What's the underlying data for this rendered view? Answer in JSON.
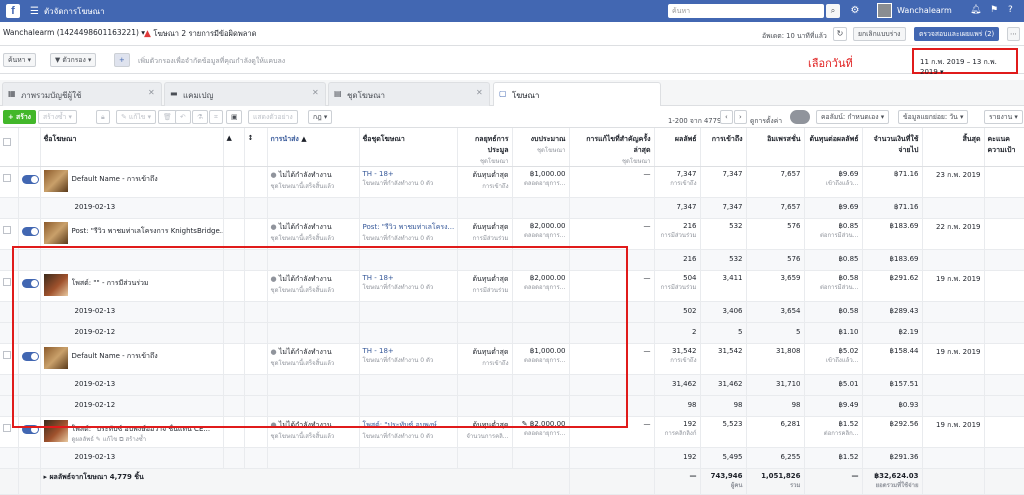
{
  "topbar": {
    "app_title": "ตัวจัดการโฆษณา",
    "search_placeholder": "ค้นหา",
    "user_name": "Wanchalearm"
  },
  "account": {
    "selector": "Wanchalearm (1424498601163221) ▾",
    "warning": "โฆษณา 2 รายการมีข้อผิดพลาด"
  },
  "status": {
    "updated": "อัพเดต: 10 นาทีที่แล้ว",
    "discard": "ยกเลิกแบบร่าง",
    "review": "ตรวจสอบและเผยแพร่ (2)"
  },
  "filter": {
    "search_btn": "ค้นหา ▾",
    "filter_btn": "▼ ตัวกรอง ▾",
    "add": "+",
    "hint": "เพิ่มตัวกรองเพื่อจำกัดข้อมูลที่คุณกำลังดูให้แคบลง"
  },
  "annotation": {
    "label": "เลือกวันที่"
  },
  "date_range": "11 ก.พ. 2019 – 13 ก.พ. 2019 ▾",
  "tabs": [
    {
      "label": "ภาพรวมบัญชีผู้ใช้"
    },
    {
      "label": "แคมเปญ"
    },
    {
      "label": "ชุดโฆษณา"
    },
    {
      "label": "โฆษณา"
    }
  ],
  "toolbar": {
    "create": "+ สร้าง",
    "duplicate": "สร้างซ้ำ ▾",
    "edit": "✎ แก้ไข ▾",
    "test": "แสดงตัวอย่าง",
    "rule": "กฎ ▾",
    "pagination": "1-200 จาก 4779",
    "breakdown_label": "ดูการตั้งค่า",
    "columns": "คอลัมน์: กำหนดเอง ▾",
    "breakdown": "ข้อมูลแยกย่อย: วัน ▾",
    "reports": "รายงาน ▾"
  },
  "columns": {
    "name": "ชื่อโฆษณา",
    "delivery": "การนำส่ง",
    "adset": "ชื่อชุดโฆษณา",
    "bid": "กลยุทธ์การประมูล",
    "bid_sub": "ชุดโฆษณา",
    "budget": "งบประมาณ",
    "budget_sub": "ชุดโฆษณา",
    "changes": "การแก้ไขที่สำคัญครั้งล่าสุด",
    "changes_sub": "ชุดโฆษณา",
    "results": "ผลลัพธ์",
    "reach": "การเข้าถึง",
    "impressions": "อิมเพรสชั่น",
    "cpr": "ต้นทุนต่อผลลัพธ์",
    "spent": "จำนวนเงินที่ใช้จ่ายไป",
    "ends": "สิ้นสุด",
    "cut": "คะแนคความเป้า"
  },
  "rows": [
    {
      "type": "main",
      "name": "Default Name - การเข้าถึง",
      "delivery": "ไม่ได้กำลังทำงาน",
      "delivery_sub": "ชุดโฆษณานี้เสร็จสิ้นแล้ว",
      "adset": "TH - 18+",
      "adset_sub": "โฆษณาที่กำลังทำงาน 0 ตัว",
      "bid": "ต้นทุนต่ำสุด",
      "bid_sub": "การเข้าถึง",
      "budget": "฿1,000.00",
      "budget_sub": "ตลอดอายุการ...",
      "changes": "—",
      "results": "7,347",
      "results_sub": "การเข้าถึง",
      "reach": "7,347",
      "impressions": "7,657",
      "cpr": "฿9.69",
      "cpr_sub": "เข้าถึงแล้ว...",
      "spent": "฿71.16",
      "ends": "23 ก.พ. 2019"
    },
    {
      "type": "sub",
      "name": "2019-02-13",
      "results": "7,347",
      "reach": "7,347",
      "impressions": "7,657",
      "cpr": "฿9.69",
      "spent": "฿71.16"
    },
    {
      "type": "main",
      "name": "Post: \"รีวิว พาชมท่าเลโครงการ KnightsBridge...",
      "delivery": "ไม่ได้กำลังทำงาน",
      "delivery_sub": "ชุดโฆษณานี้เสร็จสิ้นแล้ว",
      "adset": "Post: \"รีวิว พาชมท่าเลโครง...",
      "adset_sub": "โฆษณาที่กำลังทำงาน 0 ตัว",
      "bid": "ต้นทุนต่ำสุด",
      "bid_sub": "การมีส่วนร่วม",
      "budget": "฿2,000.00",
      "budget_sub": "ตลอดอายุการ...",
      "changes": "—",
      "results": "216",
      "results_sub": "การมีส่วนร่วม",
      "reach": "532",
      "impressions": "576",
      "cpr": "฿0.85",
      "cpr_sub": "ต่อการมีส่วน...",
      "spent": "฿183.69",
      "ends": "22 ก.พ. 2019"
    },
    {
      "type": "sub",
      "name": "",
      "results": "216",
      "reach": "532",
      "impressions": "576",
      "cpr": "฿0.85",
      "spent": "฿183.69"
    },
    {
      "type": "main",
      "name": "โพสต์: \"\" - การมีส่วนร่วม",
      "delivery": "ไม่ได้กำลังทำงาน",
      "delivery_sub": "ชุดโฆษณานี้เสร็จสิ้นแล้ว",
      "adset": "TH - 18+",
      "adset_sub": "โฆษณาที่กำลังทำงาน 0 ตัว",
      "bid": "ต้นทุนต่ำสุด",
      "bid_sub": "การมีส่วนร่วม",
      "budget": "฿2,000.00",
      "budget_sub": "ตลอดอายุการ...",
      "changes": "—",
      "results": "504",
      "results_sub": "การมีส่วนร่วม",
      "reach": "3,411",
      "impressions": "3,659",
      "cpr": "฿0.58",
      "cpr_sub": "ต่อการมีส่วน...",
      "spent": "฿291.62",
      "ends": "19 ก.พ. 2019"
    },
    {
      "type": "sub",
      "name": "2019-02-13",
      "results": "502",
      "reach": "3,406",
      "impressions": "3,654",
      "cpr": "฿0.58",
      "spent": "฿289.43"
    },
    {
      "type": "sub",
      "name": "2019-02-12",
      "results": "2",
      "reach": "5",
      "impressions": "5",
      "cpr": "฿1.10",
      "spent": "฿2.19"
    },
    {
      "type": "main",
      "name": "Default Name - การเข้าถึง",
      "delivery": "ไม่ได้กำลังทำงาน",
      "delivery_sub": "ชุดโฆษณานี้เสร็จสิ้นแล้ว",
      "adset": "TH - 18+",
      "adset_sub": "โฆษณาที่กำลังทำงาน 0 ตัว",
      "bid": "ต้นทุนต่ำสุด",
      "bid_sub": "การเข้าถึง",
      "budget": "฿1,000.00",
      "budget_sub": "ตลอดอายุการ...",
      "changes": "—",
      "results": "31,542",
      "results_sub": "การเข้าถึง",
      "reach": "31,542",
      "impressions": "31,808",
      "cpr": "฿5.02",
      "cpr_sub": "เข้าถึงแล้ว...",
      "spent": "฿158.44",
      "ends": "19 ก.พ. 2019"
    },
    {
      "type": "sub",
      "name": "2019-02-13",
      "results": "31,462",
      "reach": "31,462",
      "impressions": "31,710",
      "cpr": "฿5.01",
      "spent": "฿157.51"
    },
    {
      "type": "sub",
      "name": "2019-02-12",
      "results": "98",
      "reach": "98",
      "impressions": "98",
      "cpr": "฿9.49",
      "spent": "฿0.93"
    },
    {
      "type": "main",
      "name": "โพสต์: \"ประทับซ์ อบพงษ์ออวาจ ชื่นแทน CE...",
      "actions": "ดูผลลัพธ์ ✎ แก้ไข ⧉ สร้างซ้ำ",
      "delivery": "ไม่ได้กำลังทำงาน",
      "delivery_sub": "ชุดโฆษณานี้เสร็จสิ้นแล้ว",
      "adset": "โพสต์: \"ประทับซ์ อบพงษ์...",
      "adset_sub": "โฆษณาที่กำลังทำงาน 0 ตัว",
      "bid": "ต้นทุนต่ำสุด",
      "bid_sub": "จำนวนการคลิ...",
      "budget": "✎ ฿2,000.00",
      "budget_sub": "ตลอดอายุการ...",
      "changes": "—",
      "results": "192",
      "results_sub": "การคลิกลิงก์",
      "reach": "5,523",
      "impressions": "6,281",
      "cpr": "฿1.52",
      "cpr_sub": "ต่อการคลิก...",
      "spent": "฿292.56",
      "ends": "19 ก.พ. 2019"
    },
    {
      "type": "sub",
      "name": "2019-02-13",
      "results": "192",
      "reach": "5,495",
      "impressions": "6,255",
      "cpr": "฿1.52",
      "spent": "฿291.36"
    }
  ],
  "totals": {
    "label": "ผลลัพธ์จากโฆษณา 4,779 ชิ้น",
    "results": "—",
    "reach": "743,946",
    "reach_sub": "ผู้คน",
    "impressions": "1,051,826",
    "impressions_sub": "รวม",
    "cpr": "—",
    "spent": "฿32,624.03",
    "spent_sub": "ยอดรวมที่ใช้จ่าย"
  }
}
